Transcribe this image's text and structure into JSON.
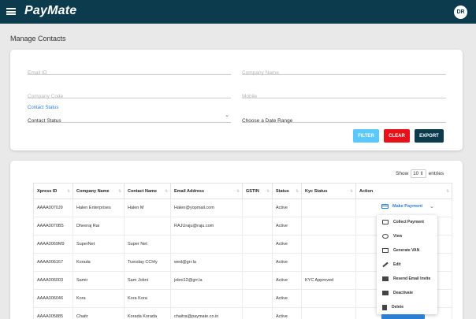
{
  "app": {
    "name": "PayMate",
    "user_initials": "DR"
  },
  "page": {
    "title": "Manage Contacts"
  },
  "filters": {
    "email_placeholder": "Email ID",
    "company_name_placeholder": "Company Name",
    "company_code_placeholder": "Company Code",
    "mobile_placeholder": "Mobile",
    "contact_status_label": "Contact Status",
    "contact_status_value": "Contact Status",
    "date_range": "Choose a Date Range",
    "filter_label": "FILTER",
    "clear_label": "CLEAR",
    "export_label": "EXPORT"
  },
  "table": {
    "show_label": "Show",
    "entries_value": "10",
    "entries_label": "entries",
    "headers": [
      "Xpress ID",
      "Company Name",
      "Contact Name",
      "Email Address",
      "GSTIN",
      "Status",
      "Kyc Status",
      "Action"
    ],
    "rows": [
      [
        "AAAA0070J9",
        "Halen Enterprises",
        "Halen M",
        "Halen@yopmail.com",
        "",
        "Active",
        "",
        ""
      ],
      [
        "AAAA0070B5",
        "Dheeraj Rai",
        "",
        "RAJUraju@raju.com",
        "",
        "Active",
        "",
        ""
      ],
      [
        "AAAA0069M9",
        "SuperNet",
        "Super Net",
        "",
        "",
        "Active",
        "",
        ""
      ],
      [
        "AAAA006167",
        "Korada",
        "Tuesday CChfy",
        "wed@grr.la",
        "",
        "Active",
        "",
        ""
      ],
      [
        "AAAA006003",
        "Samir",
        "Sam Jobni",
        "jobni12@grr.la",
        "",
        "Active",
        "KYC Approved",
        ""
      ],
      [
        "AAAA006046",
        "Kora",
        "Kora Kora",
        "",
        "",
        "Active",
        "",
        ""
      ],
      [
        "AAAA005885",
        "Chaitr",
        "Korada Korada",
        "chaitra@paymate.co.in",
        "",
        "Active",
        "",
        ""
      ]
    ]
  },
  "action": {
    "make_payment": "Make Payment",
    "menu": [
      "Collect Payment",
      "View",
      "Generate VAN",
      "Edit",
      "Resend Email Invite",
      "Deactivate",
      "Delete"
    ]
  },
  "colors": {
    "header_bg": "#0b3b4d",
    "accent": "#2a7fd4",
    "filter": "#5ac8fa",
    "clear": "#e8111a"
  }
}
